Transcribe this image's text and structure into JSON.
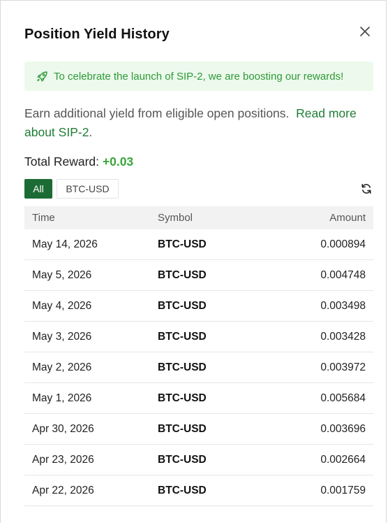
{
  "modal": {
    "title": "Position Yield History",
    "close_icon": "close-icon"
  },
  "banner": {
    "icon": "rocket-icon",
    "text": "To celebrate the launch of SIP-2, we are boosting our rewards!",
    "color": "#2e9a38",
    "background": "#ecf9ec"
  },
  "description": {
    "text": "Earn additional yield from eligible open positions.",
    "link_text": "Read more about SIP-2",
    "suffix": "."
  },
  "total_reward": {
    "label": "Total Reward:",
    "value": "+0.03",
    "value_color": "#38a639"
  },
  "filters": {
    "options": [
      "All",
      "BTC-USD"
    ],
    "selected": "All",
    "refresh_icon": "refresh-icon"
  },
  "table": {
    "columns": [
      "Time",
      "Symbol",
      "Amount"
    ],
    "rows": [
      {
        "time": "May 14, 2026",
        "symbol": "BTC-USD",
        "amount": "0.000894"
      },
      {
        "time": "May 5, 2026",
        "symbol": "BTC-USD",
        "amount": "0.004748"
      },
      {
        "time": "May 4, 2026",
        "symbol": "BTC-USD",
        "amount": "0.003498"
      },
      {
        "time": "May 3, 2026",
        "symbol": "BTC-USD",
        "amount": "0.003428"
      },
      {
        "time": "May 2, 2026",
        "symbol": "BTC-USD",
        "amount": "0.003972"
      },
      {
        "time": "May 1, 2026",
        "symbol": "BTC-USD",
        "amount": "0.005684"
      },
      {
        "time": "Apr 30, 2026",
        "symbol": "BTC-USD",
        "amount": "0.003696"
      },
      {
        "time": "Apr 23, 2026",
        "symbol": "BTC-USD",
        "amount": "0.002664"
      },
      {
        "time": "Apr 22, 2026",
        "symbol": "BTC-USD",
        "amount": "0.001759"
      }
    ]
  }
}
